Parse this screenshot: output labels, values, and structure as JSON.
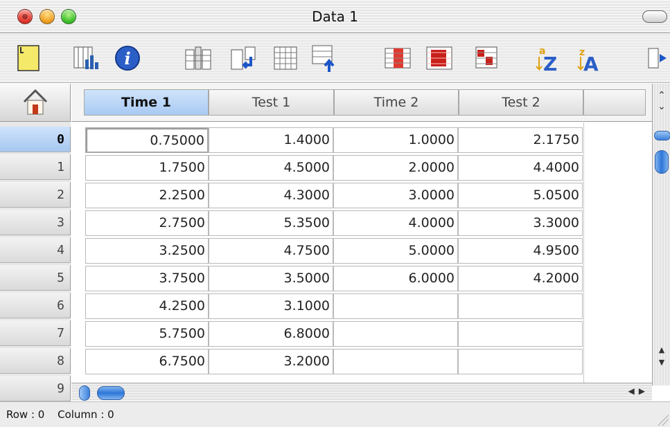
{
  "window": {
    "title": "Data 1"
  },
  "toolbar": {
    "buttons": [
      {
        "icon": "new-note-icon"
      },
      {
        "icon": "graph-icon"
      },
      {
        "icon": "info-icon"
      },
      {
        "icon": "insert-column-icon"
      },
      {
        "icon": "insert-row-icon"
      },
      {
        "icon": "delete-row-icon"
      },
      {
        "icon": "append-row-icon"
      },
      {
        "icon": "select-column-icon"
      },
      {
        "icon": "select-table-icon"
      },
      {
        "icon": "select-cells-icon"
      },
      {
        "icon": "sort-ascending-icon"
      },
      {
        "icon": "sort-descending-icon"
      },
      {
        "icon": "more-tools-icon"
      }
    ]
  },
  "table": {
    "columns": [
      "Time 1",
      "Test 1",
      "Time 2",
      "Test 2",
      ""
    ],
    "selected_column": 0,
    "row_labels": [
      "0",
      "1",
      "2",
      "3",
      "4",
      "5",
      "6",
      "7",
      "8",
      "9"
    ],
    "selected_row": 0,
    "rows": [
      [
        "0.75000",
        "1.4000",
        "1.0000",
        "2.1750"
      ],
      [
        "1.7500",
        "4.5000",
        "2.0000",
        "4.4000"
      ],
      [
        "2.2500",
        "4.3000",
        "3.0000",
        "5.0500"
      ],
      [
        "2.7500",
        "5.3500",
        "4.0000",
        "3.3000"
      ],
      [
        "3.2500",
        "4.7500",
        "5.0000",
        "4.9500"
      ],
      [
        "3.7500",
        "3.5000",
        "6.0000",
        "4.2000"
      ],
      [
        "4.2500",
        "3.1000",
        "",
        ""
      ],
      [
        "5.7500",
        "6.8000",
        "",
        ""
      ],
      [
        "6.7500",
        "3.2000",
        "",
        ""
      ]
    ]
  },
  "status": {
    "row": "Row : 0",
    "column": "Column : 0"
  },
  "colors": {
    "selected_header": "#a9caf2",
    "close": "#e0352a",
    "minimize": "#f0a020",
    "zoom": "#3ec22b",
    "scroll_thumb": "#2e76d8"
  }
}
